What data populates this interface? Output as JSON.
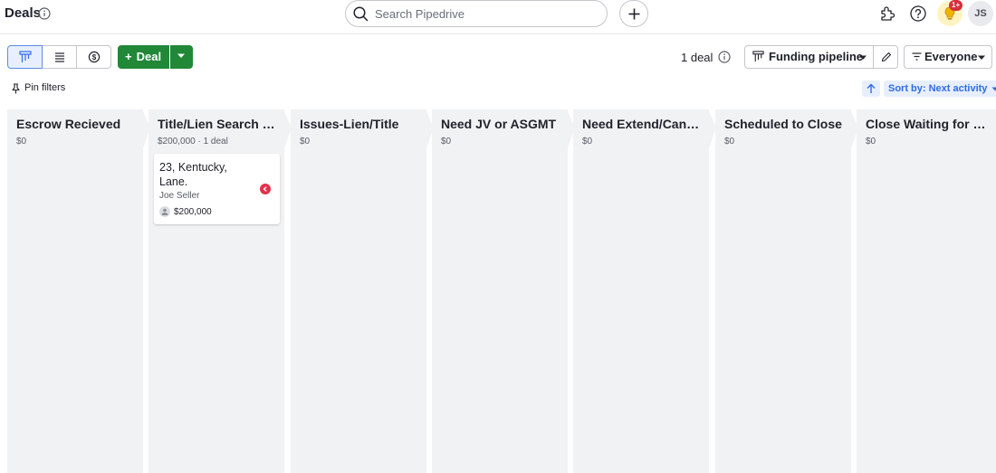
{
  "header": {
    "title": "Deals",
    "search_placeholder": "Search Pipedrive",
    "tips_badge": "1+",
    "user_initials": "JS"
  },
  "toolbar": {
    "views": [
      {
        "name": "kanban-view",
        "icon": "kanban-icon",
        "active": true
      },
      {
        "name": "list-view",
        "icon": "list-icon",
        "active": false
      },
      {
        "name": "forecast-view",
        "icon": "forecast-icon",
        "active": false
      }
    ],
    "add_deal_label": "Deal",
    "deal_count": "1 deal",
    "pipeline_label": "Funding pipeline",
    "owner_filter_label": "Everyone"
  },
  "filters": {
    "pin_label": "Pin filters",
    "sort_label": "Sort by: Next activity"
  },
  "stages": [
    {
      "name": "Escrow Recieved",
      "summary": "$0"
    },
    {
      "name": "Title/Lien Search O...",
      "summary": "$200,000 · 1 deal",
      "deals": [
        {
          "title": "23, Kentucky, Lane.",
          "person": "Joe Seller",
          "value": "$200,000",
          "status": "overdue"
        }
      ]
    },
    {
      "name": "Issues-Lien/Title",
      "summary": "$0"
    },
    {
      "name": "Need JV or ASGMT",
      "summary": "$0"
    },
    {
      "name": "Need Extend/Cancel",
      "summary": "$0"
    },
    {
      "name": "Scheduled to Close",
      "summary": "$0"
    },
    {
      "name": "Close Waiting for $$",
      "summary": "$0"
    }
  ],
  "colors": {
    "accent": "#2e6be6",
    "add_button": "#218838",
    "stage_bg": "#f1f2f4",
    "overdue": "#e0324a"
  }
}
